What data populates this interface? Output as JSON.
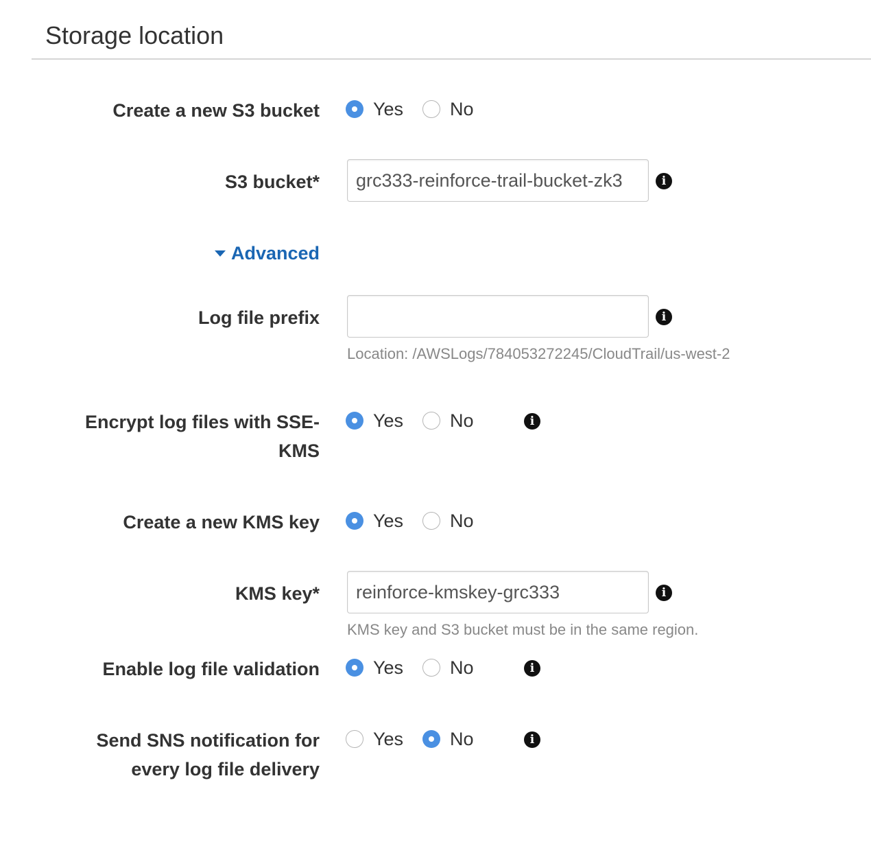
{
  "section": {
    "title": "Storage location"
  },
  "create_bucket": {
    "label": "Create a new S3 bucket",
    "yes_label": "Yes",
    "no_label": "No",
    "selected": "Yes"
  },
  "s3_bucket": {
    "label": "S3 bucket*",
    "value": "grc333-reinforce-trail-bucket-zk3"
  },
  "advanced": {
    "label": "Advanced",
    "expanded": true
  },
  "log_prefix": {
    "label": "Log file prefix",
    "value": "",
    "help": "Location: /AWSLogs/784053272245/CloudTrail/us-west-2"
  },
  "encrypt": {
    "label_line1": "Encrypt log files with SSE-",
    "label_line2": "KMS",
    "yes_label": "Yes",
    "no_label": "No",
    "selected": "Yes"
  },
  "create_kms": {
    "label": "Create a new KMS key",
    "yes_label": "Yes",
    "no_label": "No",
    "selected": "Yes"
  },
  "kms_key": {
    "label": "KMS key*",
    "value": "reinforce-kmskey-grc333",
    "help": "KMS key and S3 bucket must be in the same region."
  },
  "validation": {
    "label": "Enable log file validation",
    "yes_label": "Yes",
    "no_label": "No",
    "selected": "Yes"
  },
  "sns": {
    "label_line1": "Send SNS notification for",
    "label_line2": "every log file delivery",
    "yes_label": "Yes",
    "no_label": "No",
    "selected": "No"
  },
  "icons": {
    "info": "info-icon",
    "caret": "caret-down-icon"
  },
  "colors": {
    "accent": "#4a90e2",
    "link": "#1a66b3",
    "text": "#333333",
    "help_text": "#888888",
    "divider": "#d5d5d5"
  }
}
